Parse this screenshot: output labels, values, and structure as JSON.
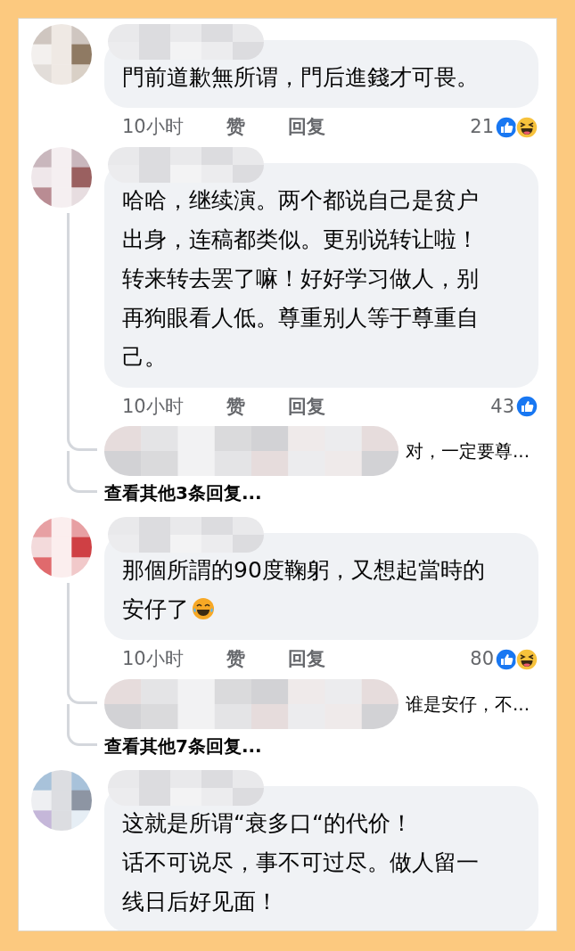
{
  "comments": [
    {
      "text": "門前道歉無所谓，門后進錢才可畏。",
      "time": "10小时",
      "like": "赞",
      "reply": "回复",
      "reaction_count": "21",
      "reactions": [
        {
          "kind": "like"
        },
        {
          "kind": "haha"
        }
      ]
    },
    {
      "text": "哈哈，继续演。两个都说自己是贫户出身，连稿都类似。更别说转让啦！转来转去罢了嘛！好好学习做人，别再狗眼看人低。尊重别人等于尊重自己。",
      "time": "10小时",
      "like": "赞",
      "reply": "回复",
      "reaction_count": "43",
      "reactions": [
        {
          "kind": "like"
        }
      ],
      "replies": [
        {
          "text": "对，一定要尊..."
        }
      ],
      "more_replies": "查看其他3条回复..."
    },
    {
      "text": "那個所謂的90度鞠躬，又想起當時的安仔了",
      "emoji": {
        "kind": "tears-of-joy"
      },
      "time": "10小时",
      "like": "赞",
      "reply": "回复",
      "reaction_count": "80",
      "reactions": [
        {
          "kind": "like"
        },
        {
          "kind": "haha"
        }
      ],
      "replies": [
        {
          "text": "谁是安仔，不..."
        }
      ],
      "more_replies": "查看其他7条回复..."
    },
    {
      "lines": [
        "这就是所谓“衰多口“的代价！",
        "话不可说尽，事不可过尽。做人留一线日后好见面！"
      ]
    }
  ]
}
